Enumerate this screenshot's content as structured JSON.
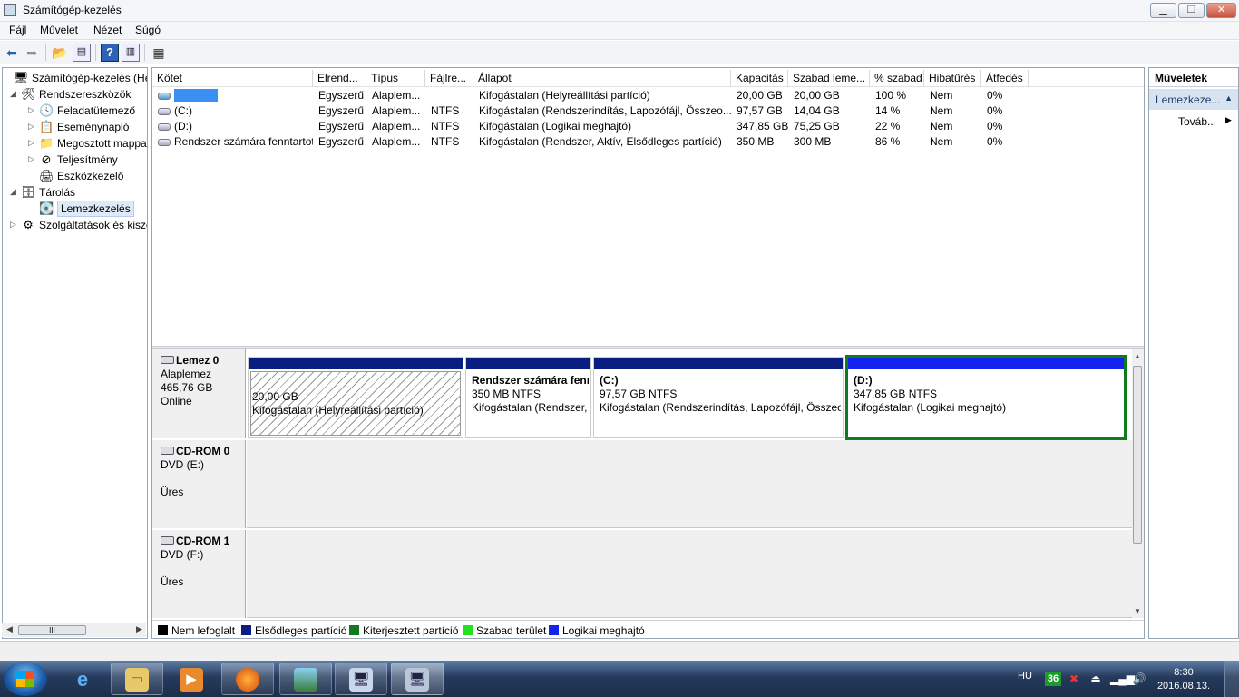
{
  "window": {
    "title": "Számítógép-kezelés",
    "minimize": "▁",
    "maximize": "❐",
    "close": "✕"
  },
  "menu": [
    "Fájl",
    "Művelet",
    "Nézet",
    "Súgó"
  ],
  "tree": [
    {
      "label": "Számítógép-kezelés (Hely",
      "level": 0,
      "expander": "",
      "icon": "computer-management-icon",
      "glyph": "🖥"
    },
    {
      "label": "Rendszereszközök",
      "level": 1,
      "expander": "◢",
      "icon": "system-tools-icon",
      "glyph": "🛠"
    },
    {
      "label": "Feladatütemező",
      "level": 2,
      "expander": "▷",
      "icon": "clock-icon",
      "glyph": "🕓"
    },
    {
      "label": "Eseménynapló",
      "level": 2,
      "expander": "▷",
      "icon": "event-viewer-icon",
      "glyph": "📋"
    },
    {
      "label": "Megosztott mappa",
      "level": 2,
      "expander": "▷",
      "icon": "shared-folder-icon",
      "glyph": "📁"
    },
    {
      "label": "Teljesítmény",
      "level": 2,
      "expander": "▷",
      "icon": "performance-icon",
      "glyph": "⊘"
    },
    {
      "label": "Eszközkezelő",
      "level": 2,
      "expander": "",
      "icon": "device-manager-icon",
      "glyph": "🖨"
    },
    {
      "label": "Tárolás",
      "level": 1,
      "expander": "◢",
      "icon": "storage-icon",
      "glyph": "🗄"
    },
    {
      "label": "Lemezkezelés",
      "level": 2,
      "expander": "",
      "icon": "disk-management-icon",
      "glyph": "💽"
    },
    {
      "label": "Szolgáltatások és kiszo",
      "level": 1,
      "expander": "▷",
      "icon": "services-icon",
      "glyph": "⚙"
    }
  ],
  "volumes_table": {
    "headers": [
      "Kötet",
      "Elrend...",
      "Típus",
      "Fájlre...",
      "Állapot",
      "Kapacitás",
      "Szabad leme...",
      "% szabad",
      "Hibatűrés",
      "Átfedés"
    ],
    "rows": [
      {
        "name": "",
        "redacted": true,
        "cells": [
          "Egyszerű",
          "Alaplem...",
          "",
          "Kifogástalan (Helyreállítási partíció)",
          "20,00 GB",
          "20,00 GB",
          "100 %",
          "Nem",
          "0%"
        ]
      },
      {
        "name": "(C:)",
        "redacted": false,
        "cells": [
          "Egyszerű",
          "Alaplem...",
          "NTFS",
          "Kifogástalan (Rendszerindítás, Lapozófájl, Összeo...",
          "97,57 GB",
          "14,04 GB",
          "14 %",
          "Nem",
          "0%"
        ]
      },
      {
        "name": "(D:)",
        "redacted": false,
        "cells": [
          "Egyszerű",
          "Alaplem...",
          "NTFS",
          "Kifogástalan (Logikai meghajtó)",
          "347,85 GB",
          "75,25 GB",
          "22 %",
          "Nem",
          "0%"
        ]
      },
      {
        "name": "Rendszer számára fenntartott",
        "redacted": false,
        "cells": [
          "Egyszerű",
          "Alaplem...",
          "NTFS",
          "Kifogástalan (Rendszer, Aktív, Elsődleges partíció)",
          "350 MB",
          "300 MB",
          "86 %",
          "Nem",
          "0%"
        ]
      }
    ]
  },
  "disks": [
    {
      "title": "Lemez 0",
      "type": "Alaplemez",
      "size": "465,76 GB",
      "status": "Online",
      "partitions": [
        {
          "name": "",
          "size": "20,00 GB",
          "status": "Kifogástalan (Helyreállítási partíció)"
        },
        {
          "name": "Rendszer számára fenn",
          "size": "350 MB NTFS",
          "status": "Kifogástalan (Rendszer,"
        },
        {
          "name": "(C:)",
          "size": "97,57 GB NTFS",
          "status": "Kifogástalan (Rendszerindítás, Lapozófájl, Összeor"
        },
        {
          "name": "(D:)",
          "size": "347,85 GB NTFS",
          "status": "Kifogástalan (Logikai meghajtó)"
        }
      ]
    },
    {
      "title": "CD-ROM 0",
      "type": "DVD (E:)",
      "status": "Üres"
    },
    {
      "title": "CD-ROM 1",
      "type": "DVD (F:)",
      "status": "Üres"
    }
  ],
  "legend": [
    {
      "label": "Nem lefoglalt",
      "color": "#000000"
    },
    {
      "label": "Elsődleges partíció",
      "color": "#0a1e82"
    },
    {
      "label": "Kiterjesztett partíció",
      "color": "#117a1d"
    },
    {
      "label": "Szabad terület",
      "color": "#22e022"
    },
    {
      "label": "Logikai meghajtó",
      "color": "#1424f0"
    }
  ],
  "actions": {
    "header": "Műveletek",
    "section": "Lemezkeze...",
    "more": "Továb..."
  },
  "taskbar": {
    "apps": [
      "internet-explorer-icon",
      "explorer-folder-icon",
      "media-player-icon",
      "firefox-icon",
      "picture-viewer-icon",
      "remote-desktop-icon",
      "computer-management-icon"
    ],
    "lang": "HU",
    "badge": "36",
    "time": "8:30",
    "date": "2016.08.13."
  }
}
